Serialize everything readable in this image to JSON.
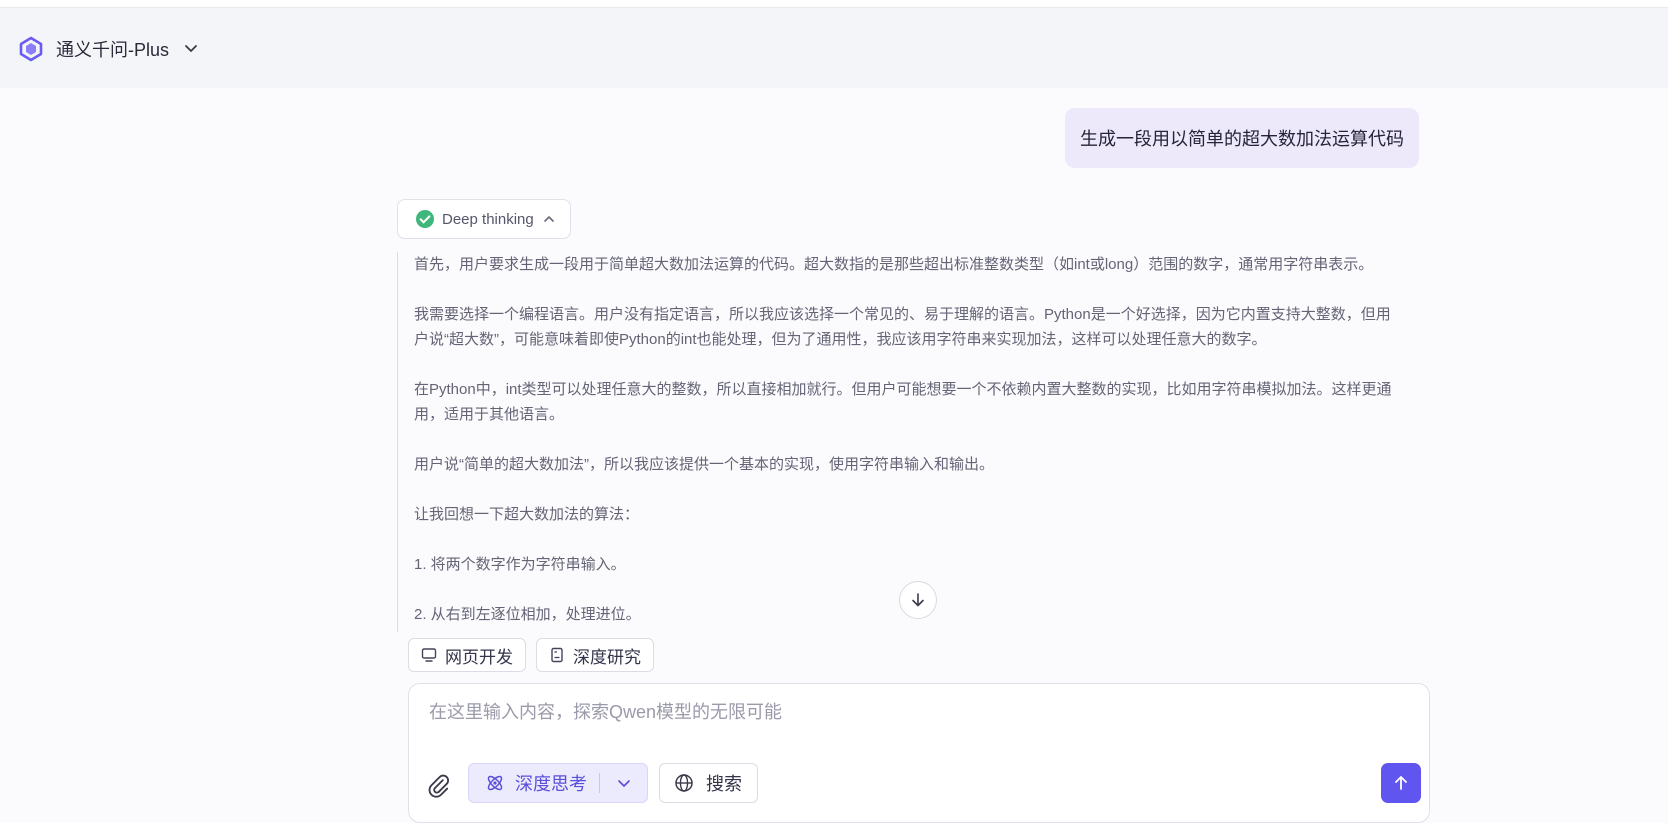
{
  "header": {
    "model_name": "通义千问-Plus",
    "logo_icon": "qwen-logo-icon",
    "dropdown_icon": "chevron-down-icon"
  },
  "conversation": {
    "user_message": "生成一段用以简单的超大数加法运算代码",
    "thinking": {
      "label": "Deep thinking",
      "status_icon": "check-circle-icon",
      "toggle_icon": "chevron-up-icon",
      "paragraphs": [
        "首先，用户要求生成一段用于简单超大数加法运算的代码。超大数指的是那些超出标准整数类型（如int或long）范围的数字，通常用字符串表示。",
        "我需要选择一个编程语言。用户没有指定语言，所以我应该选择一个常见的、易于理解的语言。Python是一个好选择，因为它内置支持大整数，但用户说“超大数”，可能意味着即使Python的int也能处理，但为了通用性，我应该用字符串来实现加法，这样可以处理任意大的数字。",
        "在Python中，int类型可以处理任意大的整数，所以直接相加就行。但用户可能想要一个不依赖内置大整数的实现，比如用字符串模拟加法。这样更通用，适用于其他语言。",
        "用户说“简单的超大数加法”，所以我应该提供一个基本的实现，使用字符串输入和输出。",
        "让我回想一下超大数加法的算法：",
        "1. 将两个数字作为字符串输入。",
        "2. 从右到左逐位相加，处理进位。"
      ]
    }
  },
  "quick_actions": [
    {
      "label": "网页开发",
      "icon": "monitor-icon"
    },
    {
      "label": "深度研究",
      "icon": "document-icon"
    }
  ],
  "composer": {
    "placeholder": "在这里输入内容，探索Qwen模型的无限可能",
    "value": "",
    "deep_think_label": "深度思考",
    "search_label": "搜索",
    "attach_icon": "paperclip-icon",
    "send_icon": "arrow-up-icon"
  },
  "colors": {
    "accent": "#6155f0",
    "user_bubble": "#ede9fb",
    "success": "#3fb67b"
  }
}
